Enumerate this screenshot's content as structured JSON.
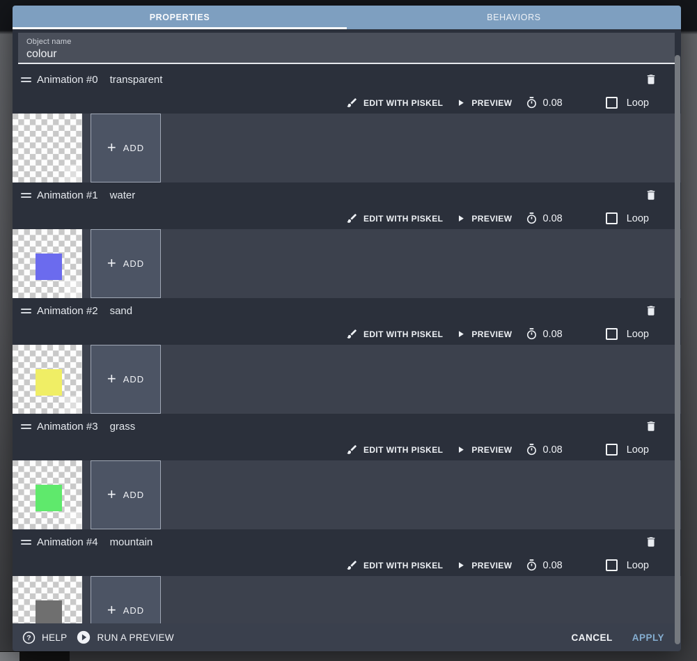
{
  "tabs": {
    "properties": "PROPERTIES",
    "behaviors": "BEHAVIORS"
  },
  "object_name": {
    "label": "Object name",
    "value": "colour"
  },
  "actions": {
    "edit_label": "EDIT WITH PISKEL",
    "preview_label": "PREVIEW",
    "loop_label": "Loop",
    "add_label": "ADD"
  },
  "animations": [
    {
      "title": "Animation #0",
      "name": "transparent",
      "delay": "0.08",
      "loop_checked": false,
      "frame_color": null
    },
    {
      "title": "Animation #1",
      "name": "water",
      "delay": "0.08",
      "loop_checked": false,
      "frame_color": "#6b6bee"
    },
    {
      "title": "Animation #2",
      "name": "sand",
      "delay": "0.08",
      "loop_checked": false,
      "frame_color": "#f0ee65"
    },
    {
      "title": "Animation #3",
      "name": "grass",
      "delay": "0.08",
      "loop_checked": false,
      "frame_color": "#5fe96c"
    },
    {
      "title": "Animation #4",
      "name": "mountain",
      "delay": "0.08",
      "loop_checked": false,
      "frame_color": "#6f6f6f"
    }
  ],
  "footer": {
    "help": "HELP",
    "run_preview": "RUN A PREVIEW",
    "cancel": "CANCEL",
    "apply": "APPLY"
  },
  "colors": {
    "tab_bar": "#7e9fc0",
    "dialog_bg": "#2b303b",
    "frames_strip": "#3c414d",
    "apply_accent": "#85aed1",
    "water_swatch": "#6b6bee",
    "sand_swatch": "#f0ee65",
    "grass_swatch": "#5fe96c",
    "mountain_swatch": "#6f6f6f"
  }
}
